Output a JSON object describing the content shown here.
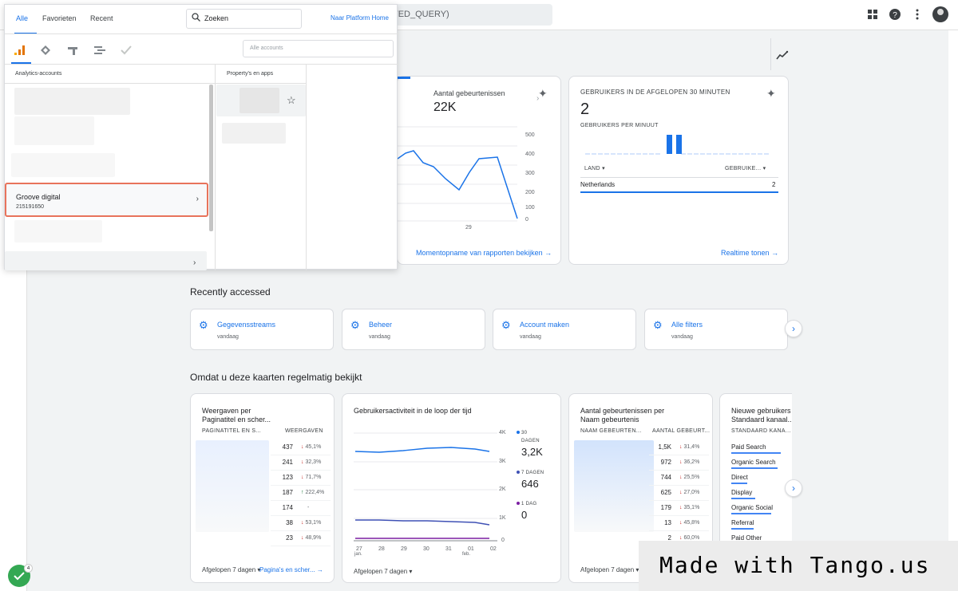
{
  "topbar": {
    "search_fragment": "TED_QUERY)"
  },
  "events_card": {
    "title": "Aantal gebeurtenissen",
    "value": "22K",
    "y_ticks": [
      "500",
      "400",
      "300",
      "200",
      "100",
      "0"
    ],
    "x_tick": "29",
    "link": "Momentopname van rapporten bekijken"
  },
  "realtime_card": {
    "title": "GEBRUIKERS IN DE AFGELOPEN 30 MINUTEN",
    "value": "2",
    "per_minute": "GEBRUIKERS PER MINUUT",
    "col_country": "LAND",
    "col_users": "GEBRUIKE...",
    "row_country": "Netherlands",
    "row_value": "2",
    "link": "Realtime tonen"
  },
  "recently": {
    "title": "Recently accessed",
    "items": [
      {
        "label": "Gegevensstreams",
        "sub": "vandaag"
      },
      {
        "label": "Beheer",
        "sub": "vandaag"
      },
      {
        "label": "Account maken",
        "sub": "vandaag"
      },
      {
        "label": "Alle filters",
        "sub": "vandaag"
      }
    ]
  },
  "frequent": {
    "title": "Omdat u deze kaarten regelmatig bekijkt",
    "views_card": {
      "title1": "Weergaven per",
      "title2": "Paginatitel en scher...",
      "col1": "PAGINATITEL EN S...",
      "col2": "WEERGAVEN",
      "rows": [
        {
          "v": "437",
          "c": "45,1%",
          "d": "down"
        },
        {
          "v": "241",
          "c": "32,3%",
          "d": "down"
        },
        {
          "v": "123",
          "c": "71,7%",
          "d": "down"
        },
        {
          "v": "187",
          "c": "222,4%",
          "d": "up"
        },
        {
          "v": "174",
          "c": "-",
          "d": "none"
        },
        {
          "v": "38",
          "c": "53,1%",
          "d": "down"
        },
        {
          "v": "23",
          "c": "48,9%",
          "d": "down"
        }
      ],
      "footer": "Afgelopen 7 dagen",
      "link": "Pagina's en scher..."
    },
    "activity_card": {
      "title": "Gebruikersactiviteit in de loop der tijd",
      "y_ticks": [
        "4K",
        "3K",
        "2K",
        "1K",
        "0"
      ],
      "x_ticks": [
        "27",
        "28",
        "29",
        "30",
        "31",
        "01",
        "02"
      ],
      "x_sub1": "jan.",
      "x_sub2": "feb.",
      "legend": [
        {
          "label1": "30",
          "label2": "DAGEN",
          "value": "3,2K",
          "color": "#1a73e8"
        },
        {
          "label1": "7 DAGEN",
          "label2": "",
          "value": "646",
          "color": "#3f51b5"
        },
        {
          "label1": "1 DAG",
          "label2": "",
          "value": "0",
          "color": "#7b1fa2"
        }
      ],
      "footer": "Afgelopen 7 dagen"
    },
    "events_name_card": {
      "title1": "Aantal gebeurtenissen per",
      "title2": "Naam gebeurtenis",
      "col1": "NAAM GEBEURTEN...",
      "col2": "AANTAL GEBEURT...",
      "rows": [
        {
          "v": "1,5K",
          "c": "31,4%",
          "d": "down"
        },
        {
          "v": "972",
          "c": "36,2%",
          "d": "down"
        },
        {
          "v": "744",
          "c": "25,5%",
          "d": "down"
        },
        {
          "v": "625",
          "c": "27,0%",
          "d": "down"
        },
        {
          "v": "179",
          "c": "35,1%",
          "d": "down"
        },
        {
          "v": "13",
          "c": "45,8%",
          "d": "down"
        },
        {
          "v": "2",
          "c": "60,0%",
          "d": "down"
        }
      ],
      "footer": "Afgelopen 7 dagen"
    },
    "new_users_card": {
      "title1": "Nieuwe gebruikers",
      "title2": "Standaard kanaal...",
      "col1": "STANDAARD KANA...",
      "rows": [
        "Paid Search",
        "Organic Search",
        "Direct",
        "Display",
        "Organic Social",
        "Referral",
        "Paid Other"
      ]
    }
  },
  "panel": {
    "tabs": [
      "Alle",
      "Favorieten",
      "Recent"
    ],
    "search_value": "Zoeken",
    "platform_link": "Naar Platform Home",
    "account_search_placeholder": "Alle accounts",
    "col_accounts": "Analytics-accounts",
    "col_properties": "Property's en apps",
    "selected_account": {
      "name": "Groove digital",
      "id": "215191650"
    }
  },
  "watermark": "Made with Tango.us",
  "badge_count": "4"
}
